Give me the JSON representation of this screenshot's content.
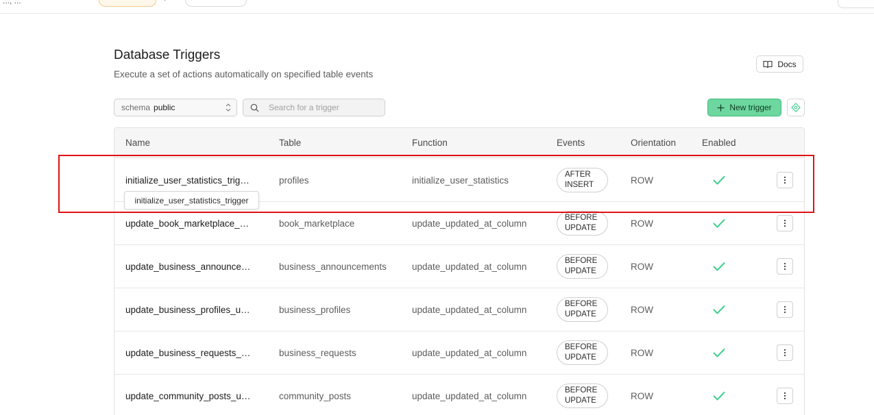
{
  "header": {
    "title": "Database Triggers",
    "subtitle": "Execute a set of actions automatically on specified table events",
    "docs_label": "Docs"
  },
  "toolbar": {
    "schema_label": "schema",
    "schema_value": "public",
    "search_placeholder": "Search for a trigger",
    "new_trigger_label": "New trigger"
  },
  "table": {
    "columns": [
      "Name",
      "Table",
      "Function",
      "Events",
      "Orientation",
      "Enabled"
    ],
    "rows": [
      {
        "name": "initialize_user_statistics_trig…",
        "table": "profiles",
        "function": "initialize_user_statistics",
        "event_line1": "AFTER",
        "event_line2": "INSERT",
        "orientation": "ROW",
        "enabled": true
      },
      {
        "name": "update_book_marketplace_…",
        "table": "book_marketplace",
        "function": "update_updated_at_column",
        "event_line1": "BEFORE",
        "event_line2": "UPDATE",
        "orientation": "ROW",
        "enabled": true
      },
      {
        "name": "update_business_announce…",
        "table": "business_announcements",
        "function": "update_updated_at_column",
        "event_line1": "BEFORE",
        "event_line2": "UPDATE",
        "orientation": "ROW",
        "enabled": true
      },
      {
        "name": "update_business_profiles_u…",
        "table": "business_profiles",
        "function": "update_updated_at_column",
        "event_line1": "BEFORE",
        "event_line2": "UPDATE",
        "orientation": "ROW",
        "enabled": true
      },
      {
        "name": "update_business_requests_…",
        "table": "business_requests",
        "function": "update_updated_at_column",
        "event_line1": "BEFORE",
        "event_line2": "UPDATE",
        "orientation": "ROW",
        "enabled": true
      },
      {
        "name": "update_community_posts_u…",
        "table": "community_posts",
        "function": "update_updated_at_column",
        "event_line1": "BEFORE",
        "event_line2": "UPDATE",
        "orientation": "ROW",
        "enabled": true
      }
    ]
  },
  "tooltip": {
    "text": "initialize_user_statistics_trigger"
  },
  "colors": {
    "accent_green": "#3ecf8e",
    "check_green": "#3ecf8e",
    "highlight_red": "#e01010"
  },
  "icons": {
    "docs": "book-icon",
    "search": "search-icon",
    "add": "plus-icon",
    "more": "more-vertical-icon",
    "enabled": "check-icon",
    "extra": "diamond-icon"
  }
}
